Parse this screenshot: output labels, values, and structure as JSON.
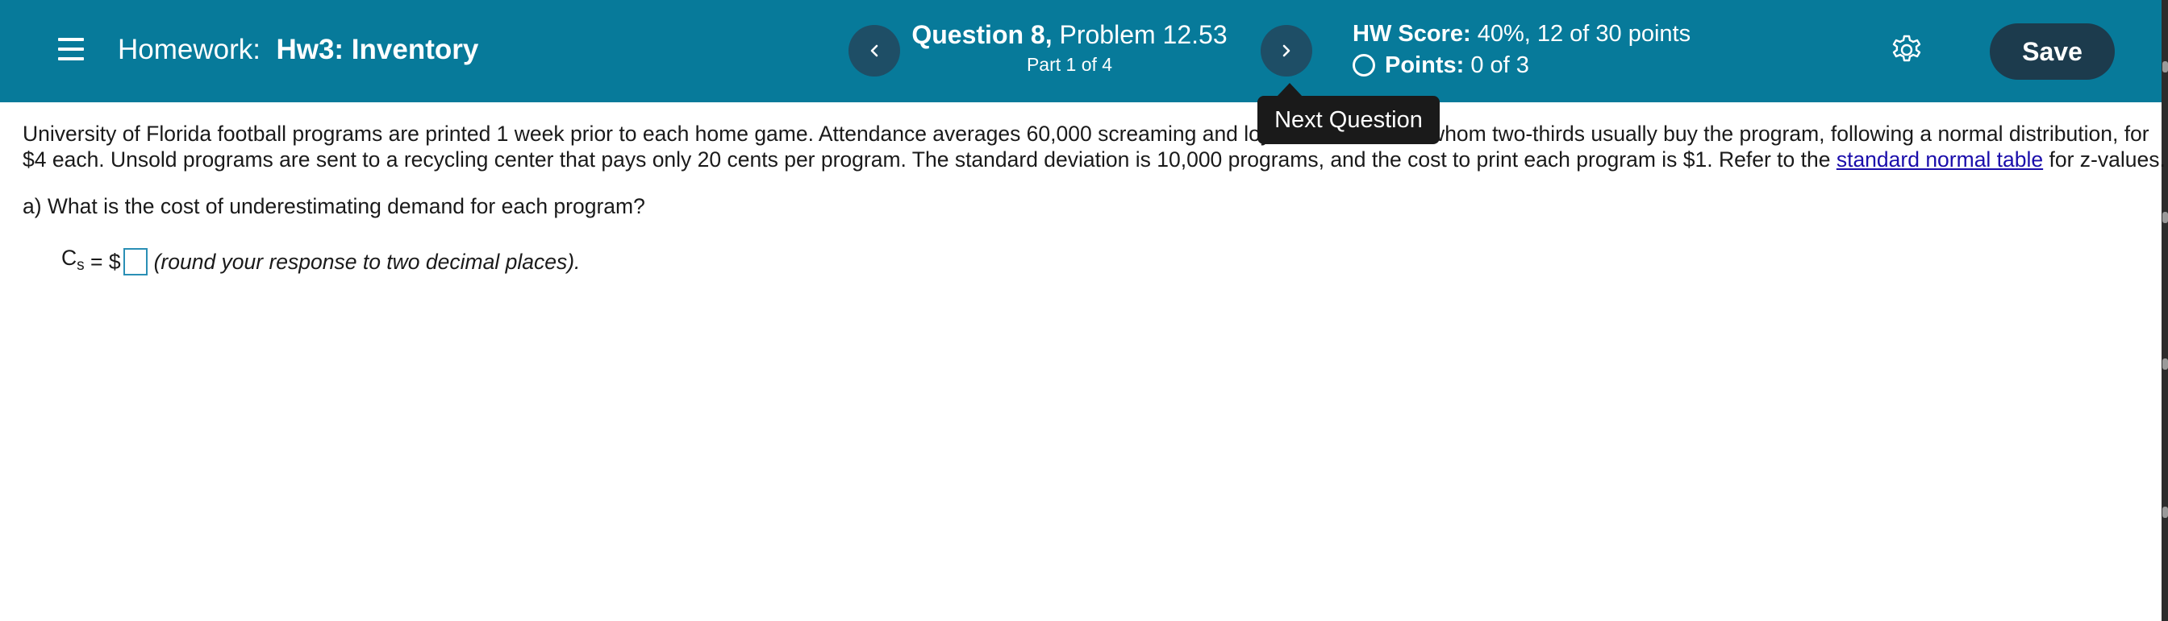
{
  "header": {
    "menu_icon": "hamburger-menu-icon",
    "homework_label": "Homework:",
    "homework_name": "Hw3: Inventory",
    "prev_icon": "chevron-left-icon",
    "next_icon": "chevron-right-icon",
    "question_label": "Question 8,",
    "problem_label": "Problem 12.53",
    "part_label": "Part 1 of 4",
    "hw_score_label": "HW Score:",
    "hw_score_value": "40%, 12 of 30 points",
    "points_label": "Points:",
    "points_value": "0 of 3",
    "settings_icon": "gear-icon",
    "save_label": "Save",
    "background_color": "#077a9a"
  },
  "tooltip": {
    "text": "Next Question"
  },
  "problem": {
    "line1": "University of Florida football programs are printed 1 week prior to each home game. Attendance averages 60,000 screaming and loyal Gator fans, of whom two-thirds usually buy the program, following a normal distribution, for",
    "line2_pre": "$4 each. Unsold programs are sent to a recycling center that pays only 20 cents per program. The standard deviation is 10,000 programs, and the cost to print each program is $1. Refer to the ",
    "link_text": "standard normal table",
    "line2_post": " for z-values."
  },
  "question_a": {
    "prompt": "a) What is the cost of underestimating demand for each program?",
    "var_main": "C",
    "var_sub": "s",
    "equals": " = $",
    "answer_value": "",
    "hint": "(round your response to two decimal places)."
  }
}
